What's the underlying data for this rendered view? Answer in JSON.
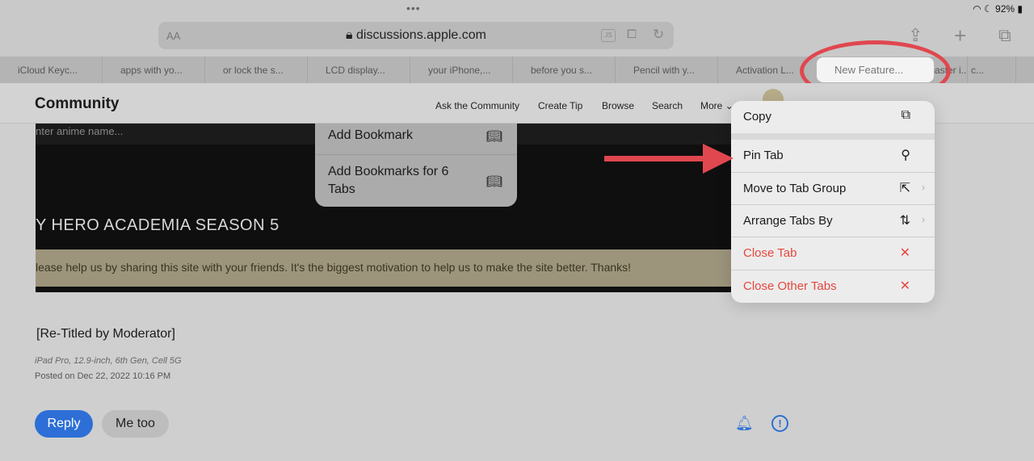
{
  "status": {
    "dots": "•••",
    "battery": "92%"
  },
  "toolbar": {
    "reader": "AA",
    "url": "discussions.apple.com",
    "js": "JS",
    "share_icon": "share-icon",
    "new_tab": "+",
    "tabs_icon": "tabs-icon"
  },
  "tabs": [
    "iCloud Keyc...",
    "apps with yo...",
    "or lock the s...",
    "LCD display...",
    "your iPhone,...",
    "before you s...",
    "Pencil with y...",
    "Activation L...",
    "New Feature...",
    "master i...",
    "c..."
  ],
  "active_tab": "New Feature...",
  "header": {
    "brand": "Community",
    "nav": [
      "Ask the Community",
      "Create Tip",
      "Browse",
      "Search",
      "More ⌄"
    ]
  },
  "hero": {
    "search_placeholder": "nter anime name...",
    "title": "Y HERO ACADEMIA SEASON 5",
    "banner": "lease help us by sharing this site with your friends. It's the biggest motivation to help us to make the site better. Thanks!"
  },
  "bookmark_menu": [
    {
      "label": "Add Bookmark",
      "icon": "book-icon"
    },
    {
      "label": "Add Bookmarks for 6 Tabs",
      "icon": "book-icon"
    }
  ],
  "context_menu": [
    {
      "label": "Copy",
      "icon": "⧉"
    },
    {
      "label": "Pin Tab",
      "icon": "📌"
    },
    {
      "label": "Move to Tab Group",
      "icon": "⇱",
      "chevron": true
    },
    {
      "label": "Arrange Tabs By",
      "icon": "⇅",
      "chevron": true
    },
    {
      "label": "Close Tab",
      "icon": "✕",
      "destructive": true
    },
    {
      "label": "Close Other Tabs",
      "icon": "✕",
      "destructive": true
    }
  ],
  "post": {
    "title": "[Re-Titled by Moderator]",
    "device": "iPad Pro, 12.9-inch, 6th Gen, Cell 5G",
    "posted": "Posted on Dec 22, 2022 10:16 PM",
    "reply": "Reply",
    "me_too": "Me too"
  },
  "colors": {
    "annotation": "#e0474f",
    "accent": "#2d6fd6",
    "destructive": "#e5483f"
  }
}
